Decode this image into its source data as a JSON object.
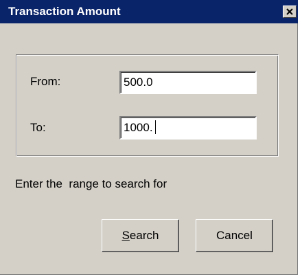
{
  "window": {
    "title": "Transaction Amount"
  },
  "form": {
    "from_label": "From:",
    "from_value": "500.0",
    "to_label": "To:",
    "to_value": "1000."
  },
  "hint": "Enter the  range to search for",
  "buttons": {
    "search_label": "Search",
    "search_mnemonic": "S",
    "search_rest": "earch",
    "cancel_label": "Cancel"
  },
  "icons": {
    "close": "close-icon"
  },
  "colors": {
    "titlebar": "#0a246a",
    "dialog_face": "#d4d0c8",
    "field_background": "#ffffff"
  }
}
